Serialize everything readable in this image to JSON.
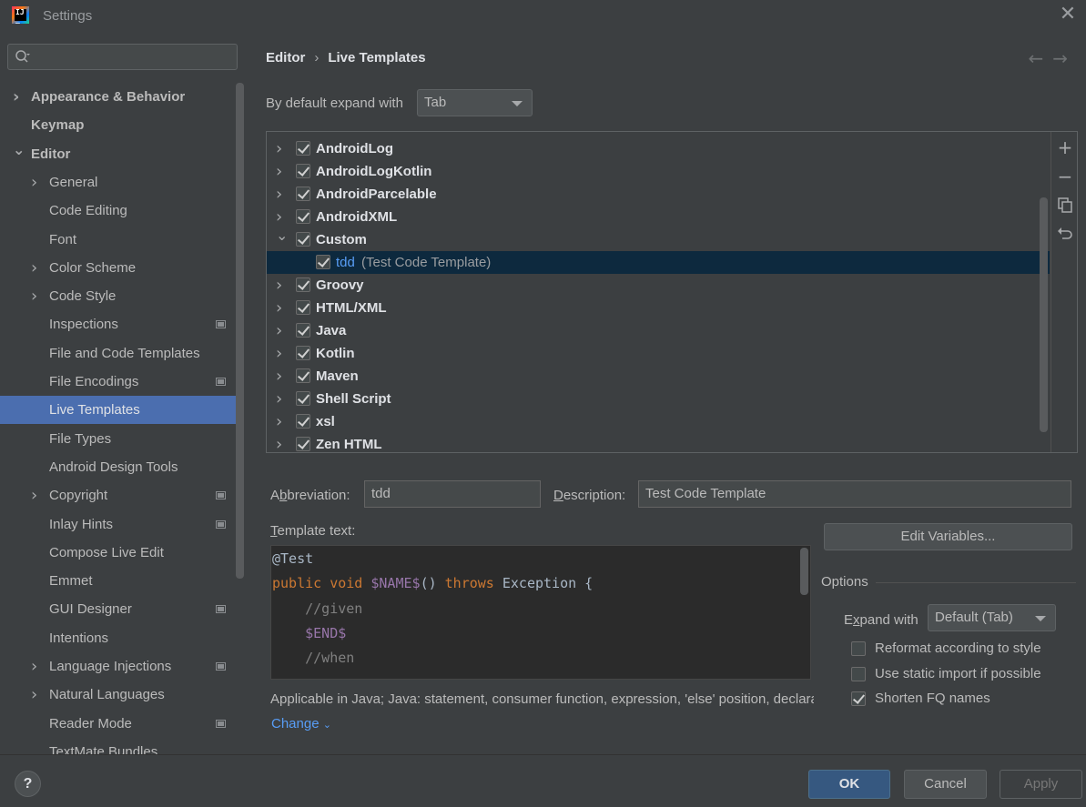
{
  "window": {
    "title": "Settings"
  },
  "sidebar": {
    "search_placeholder": "",
    "items": [
      {
        "label": "Appearance & Behavior",
        "level": 0,
        "expandable": true,
        "expanded": false,
        "bold": true
      },
      {
        "label": "Keymap",
        "level": 0,
        "expandable": false,
        "bold": true
      },
      {
        "label": "Editor",
        "level": 0,
        "expandable": true,
        "expanded": true,
        "bold": true
      },
      {
        "label": "General",
        "level": 1,
        "expandable": true
      },
      {
        "label": "Code Editing",
        "level": 1
      },
      {
        "label": "Font",
        "level": 1
      },
      {
        "label": "Color Scheme",
        "level": 1,
        "expandable": true
      },
      {
        "label": "Code Style",
        "level": 1,
        "expandable": true
      },
      {
        "label": "Inspections",
        "level": 1,
        "project": true
      },
      {
        "label": "File and Code Templates",
        "level": 1
      },
      {
        "label": "File Encodings",
        "level": 1,
        "project": true
      },
      {
        "label": "Live Templates",
        "level": 1,
        "selected": true
      },
      {
        "label": "File Types",
        "level": 1
      },
      {
        "label": "Android Design Tools",
        "level": 1
      },
      {
        "label": "Copyright",
        "level": 1,
        "expandable": true,
        "project": true
      },
      {
        "label": "Inlay Hints",
        "level": 1,
        "project": true
      },
      {
        "label": "Compose Live Edit",
        "level": 1
      },
      {
        "label": "Emmet",
        "level": 1
      },
      {
        "label": "GUI Designer",
        "level": 1,
        "project": true
      },
      {
        "label": "Intentions",
        "level": 1
      },
      {
        "label": "Language Injections",
        "level": 1,
        "expandable": true,
        "project": true
      },
      {
        "label": "Natural Languages",
        "level": 1,
        "expandable": true
      },
      {
        "label": "Reader Mode",
        "level": 1,
        "project": true
      },
      {
        "label": "TextMate Bundles",
        "level": 1
      }
    ]
  },
  "breadcrumb": {
    "parent": "Editor",
    "current": "Live Templates"
  },
  "expand_default": {
    "label": "By default expand with",
    "value": "Tab"
  },
  "template_groups": [
    {
      "label": "AndroidLog",
      "checked": true,
      "expanded": false
    },
    {
      "label": "AndroidLogKotlin",
      "checked": true,
      "expanded": false
    },
    {
      "label": "AndroidParcelable",
      "checked": true,
      "expanded": false
    },
    {
      "label": "AndroidXML",
      "checked": true,
      "expanded": false
    },
    {
      "label": "Custom",
      "checked": true,
      "expanded": true
    },
    {
      "label": "tdd",
      "desc": "(Test Code Template)",
      "checked": true,
      "child": true,
      "selected": true
    },
    {
      "label": "Groovy",
      "checked": true,
      "expanded": false
    },
    {
      "label": "HTML/XML",
      "checked": true,
      "expanded": false
    },
    {
      "label": "Java",
      "checked": true,
      "expanded": false
    },
    {
      "label": "Kotlin",
      "checked": true,
      "expanded": false
    },
    {
      "label": "Maven",
      "checked": true,
      "expanded": false
    },
    {
      "label": "Shell Script",
      "checked": true,
      "expanded": false
    },
    {
      "label": "xsl",
      "checked": true,
      "expanded": false
    },
    {
      "label": "Zen HTML",
      "checked": true,
      "expanded": false
    }
  ],
  "form": {
    "abbreviation_label_pre": "A",
    "abbreviation_label_u": "b",
    "abbreviation_label_post": "breviation:",
    "abbreviation_value": "tdd",
    "description_label_u": "D",
    "description_label_post": "escription:",
    "description_value": "Test Code Template",
    "template_text_label_u": "T",
    "template_text_label_post": "emplate text:",
    "edit_variables": "Edit Variables...",
    "options_title": "Options",
    "expand_with_label_pre": "E",
    "expand_with_label_u": "x",
    "expand_with_label_post": "pand with",
    "expand_with_value": "Default (Tab)",
    "reformat": {
      "label": "Reformat according to style",
      "checked": false
    },
    "static_import": {
      "label": "Use static import if possible",
      "checked": false
    },
    "shorten_fq": {
      "label": "Shorten FQ names",
      "checked": true
    },
    "applicable": "Applicable in Java; Java: statement, consumer function, expression, 'else' position, declaration, comment, string, smart type completion, other.",
    "change_link": "Change"
  },
  "code": {
    "l1": "@Test",
    "l2_kw1": "public",
    "l2_kw2": "void",
    "l2_var": "$NAME$",
    "l2_mid": "() ",
    "l2_kw3": "throws",
    "l2_end": " Exception {",
    "l3": "    //given",
    "l4": "$END$",
    "l5": "    //when"
  },
  "buttons": {
    "ok": "OK",
    "cancel": "Cancel",
    "apply": "Apply",
    "help": "?"
  },
  "colors": {
    "accent": "#4b6eaf",
    "selected_row": "#0d293e",
    "link": "#589df6",
    "primary_button": "#365880"
  }
}
